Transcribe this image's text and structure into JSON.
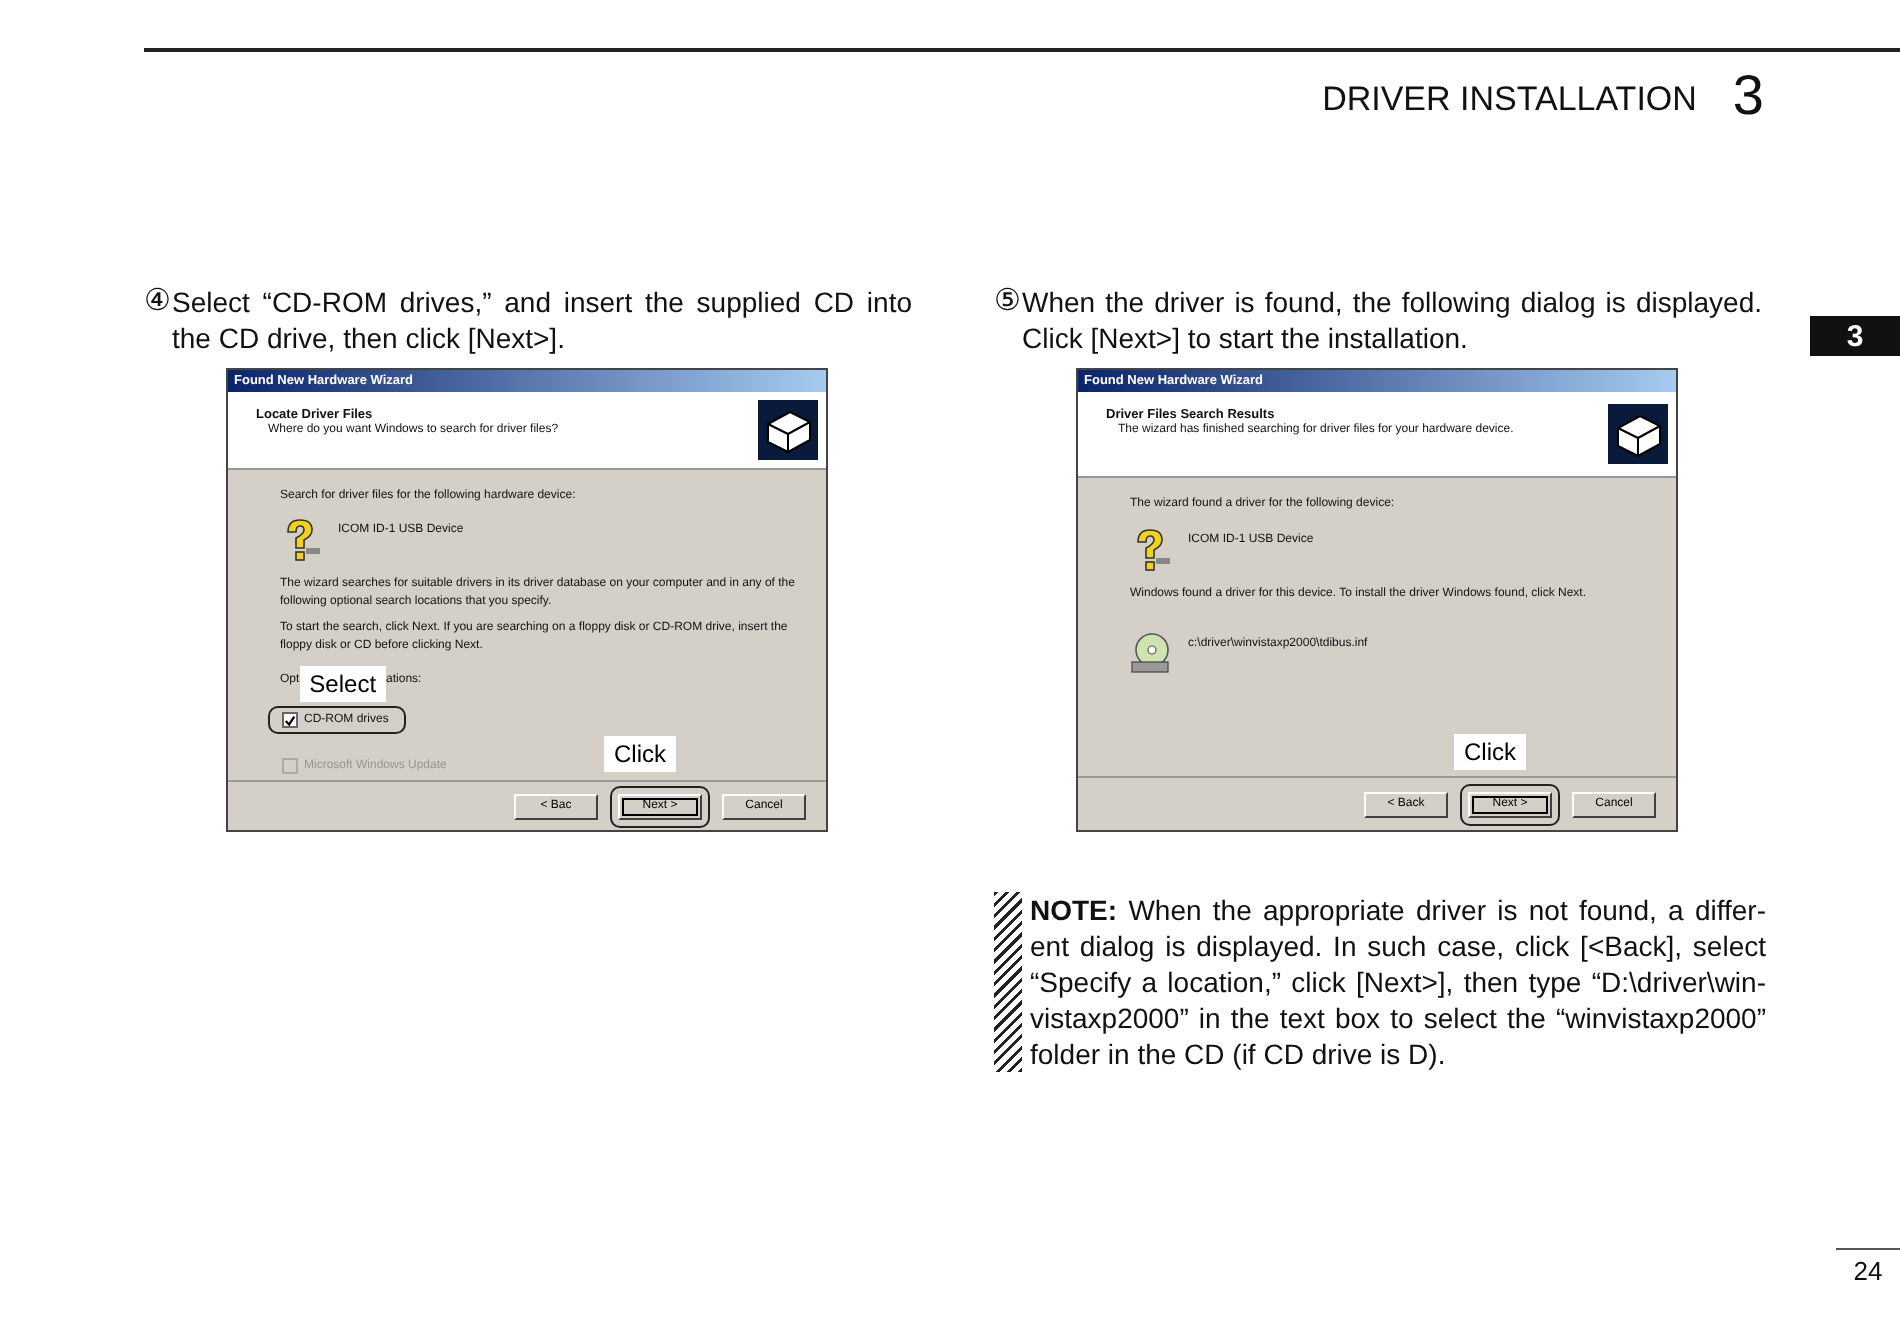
{
  "header": {
    "title": "DRIVER INSTALLATION",
    "chapter": "3"
  },
  "side_tab": "3",
  "steps": [
    {
      "number": "④",
      "text": "Select “CD-ROM drives,” and insert the supplied CD into the CD drive, then click [Next>].",
      "dialog": {
        "title": "Found New Hardware Wizard",
        "heading": "Locate Driver Files",
        "subheading": "Where do you want Windows to search for driver files?",
        "body": [
          {
            "kind": "text",
            "text": "Search for driver files for the following hardware device:"
          },
          {
            "kind": "device",
            "text": "ICOM ID-1 USB Device"
          },
          {
            "kind": "text",
            "text": "The wizard searches for suitable drivers in its driver database on your computer and in any of the following optional search locations that you specify."
          },
          {
            "kind": "text",
            "text": "To start the search, click Next. If you are searching on a floppy disk or CD-ROM drive, insert the floppy disk or CD before clicking Next."
          },
          {
            "kind": "options_label",
            "before": "Opt",
            "callout": "Select",
            "after": "ations:"
          },
          {
            "kind": "checkbox",
            "label": "CD-ROM drives",
            "checked": true,
            "disabled": false,
            "highlighted": true
          },
          {
            "kind": "checkbox",
            "label": "Microsoft Windows Update",
            "checked": false,
            "disabled": true,
            "highlighted": false
          }
        ],
        "buttons": [
          {
            "label": "< Bac",
            "highlighted": false
          },
          {
            "label": "Next >",
            "highlighted": true,
            "callout": "Click"
          },
          {
            "label": "Cancel",
            "highlighted": false
          }
        ]
      }
    },
    {
      "number": "⑤",
      "text": "When the driver is found, the following dialog is displayed. Click [Next>] to start the installation.",
      "dialog": {
        "title": "Found New Hardware Wizard",
        "heading": "Driver Files Search Results",
        "subheading": "The wizard has finished searching for driver files for your hardware device.",
        "body": [
          {
            "kind": "text",
            "text": "The wizard found a driver for the following device:"
          },
          {
            "kind": "device",
            "text": "ICOM ID-1 USB Device"
          },
          {
            "kind": "text",
            "text": "Windows found a driver for this device. To install the driver Windows found, click Next."
          },
          {
            "kind": "file",
            "text": "c:\\driver\\winvistaxp2000\\tdibus.inf"
          }
        ],
        "buttons": [
          {
            "label": "< Back",
            "highlighted": false
          },
          {
            "label": "Next >",
            "highlighted": true,
            "callout": "Click"
          },
          {
            "label": "Cancel",
            "highlighted": false
          }
        ]
      }
    }
  ],
  "note": "**NOTE:** When the appropriate driver is not found, a differ-ent dialog is displayed. In such case, click [<Back], select “Specify a location,” click [Next>], then type “D:\\driver\\win-vistaxp2000” in the text box to select the “winvistaxp2000” folder in the CD (if CD drive is D).",
  "page_number": "24"
}
